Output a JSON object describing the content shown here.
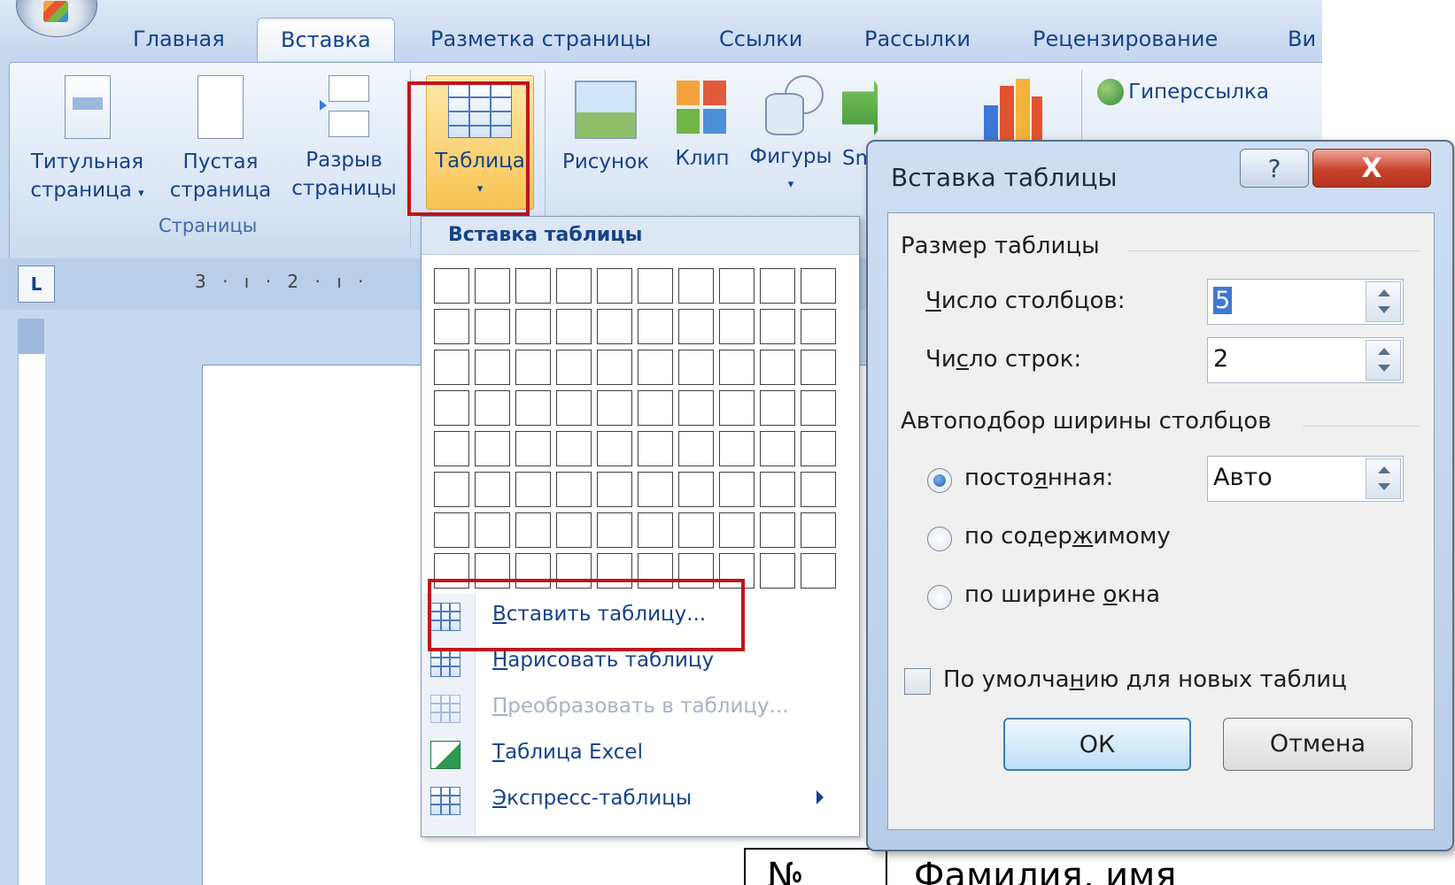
{
  "ribbon_tabs": [
    "Главная",
    "Вставка",
    "Разметка страницы",
    "Ссылки",
    "Рассылки",
    "Рецензирование",
    "Ви"
  ],
  "ribbon": {
    "title_page": [
      "Титульная",
      "страница"
    ],
    "blank_page": [
      "Пустая",
      "страница"
    ],
    "page_break": [
      "Разрыв",
      "страницы"
    ],
    "pages_group": "Страницы",
    "table": "Таблица",
    "picture": "Рисунок",
    "clip": "Клип",
    "shapes": "Фигуры",
    "smartart_partial": "Sm",
    "hyperlink": "Гиперссылка"
  },
  "ruler_text": "3 · ı · 2 · ı ·",
  "ruler_corner": "L",
  "menu": {
    "header": "Вставка таблицы",
    "grid_cols": 10,
    "grid_rows": 8,
    "items": [
      {
        "pre": "",
        "ul": "В",
        "post": "ставить таблицу...",
        "icon": "insert-table-icon",
        "disabled": false
      },
      {
        "pre": "",
        "ul": "Н",
        "post": "арисовать таблицу",
        "icon": "draw-table-icon",
        "disabled": false
      },
      {
        "pre": "",
        "ul": "П",
        "post": "реобразовать в таблицу...",
        "icon": "convert-table-icon",
        "disabled": true
      },
      {
        "pre": "",
        "ul": "Т",
        "post": "аблица Excel",
        "icon": "excel-table-icon",
        "disabled": false
      },
      {
        "pre": "",
        "ul": "Э",
        "post": "кспресс-таблицы",
        "icon": "quick-tables-icon",
        "disabled": false
      }
    ]
  },
  "dialog": {
    "title": "Вставка таблицы",
    "help": "?",
    "close": "X",
    "size_section": "Размер таблицы",
    "cols_label": {
      "ul": "Ч",
      "post": "исло столбцов:"
    },
    "cols_value": "5",
    "rows_label": {
      "pre": "Чи",
      "ul": "с",
      "post": "ло строк:"
    },
    "rows_value": "2",
    "autofit_section": "Автоподбор ширины столбцов",
    "fixed": {
      "pre": "посто",
      "ul": "я",
      "post": "нная:"
    },
    "fixed_value": "Авто",
    "content": {
      "pre": "по содер",
      "ul": "ж",
      "post": "имому"
    },
    "window": {
      "pre": "по ширине ",
      "ul": "о",
      "post": "кна"
    },
    "remember": {
      "pre": "По умолча",
      "ul": "н",
      "post": "ию для новых таблиц"
    },
    "ok": "ОК",
    "cancel": "Отмена"
  },
  "document": {
    "cell1": "№",
    "cell2": "Фамилия, имя"
  },
  "colors": {
    "ribbon_text": "#15428b",
    "highlight_red": "#c0141c",
    "close_red": "#c8412b"
  }
}
